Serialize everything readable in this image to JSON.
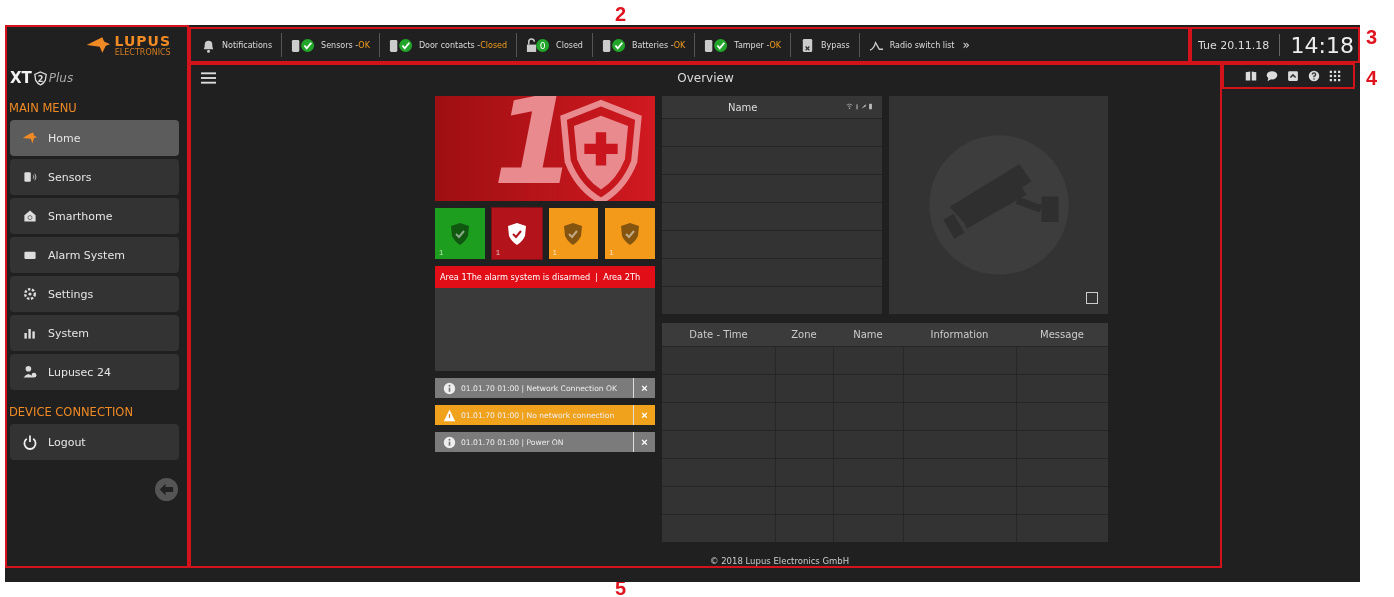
{
  "callouts": [
    "2",
    "3",
    "4",
    "5"
  ],
  "sidebar": {
    "logo": {
      "name": "LUPUS",
      "subtext": "ELECTRONICS"
    },
    "product": {
      "name": "XT",
      "badge": "2",
      "suffix": "Plus"
    },
    "sections": [
      {
        "title": "MAIN MENU",
        "items": [
          {
            "label": "Home",
            "selected": true
          },
          {
            "label": "Sensors",
            "selected": false
          },
          {
            "label": "Smarthome",
            "selected": false
          },
          {
            "label": "Alarm System",
            "selected": false
          },
          {
            "label": "Settings",
            "selected": false
          },
          {
            "label": "System",
            "selected": false
          },
          {
            "label": "Lupusec 24",
            "selected": false
          }
        ]
      },
      {
        "title": "DEVICE CONNECTION",
        "items": [
          {
            "label": "Logout",
            "selected": false
          }
        ]
      }
    ]
  },
  "status_bar": {
    "items": [
      {
        "label": "Notifications",
        "checked": false
      },
      {
        "label": "Sensors -",
        "status": "OK",
        "checked": true
      },
      {
        "label": "Door contacts -",
        "status": "Closed",
        "checked": true
      },
      {
        "label": "Closed",
        "badge": "0",
        "checked": false
      },
      {
        "label": "Batteries -",
        "status": "OK",
        "checked": true
      },
      {
        "label": "Tamper -",
        "status": "OK",
        "checked": true
      },
      {
        "label": "Bypass",
        "checked": false
      },
      {
        "label": "Radio switch list",
        "checked": false
      }
    ],
    "more": "»"
  },
  "clock": {
    "date": "Tue 20.11.18",
    "time": "14:18"
  },
  "main": {
    "title": "Overview",
    "alarm": {
      "area": "1",
      "tiles": [
        {
          "color": "#1e9e1e",
          "number": "1",
          "selected": false
        },
        {
          "color": "#b3141b",
          "number": "1",
          "selected": true
        },
        {
          "color": "#f39a1a",
          "number": "1",
          "selected": false
        },
        {
          "color": "#f39a1a",
          "number": "1",
          "selected": false
        }
      ],
      "marquee": "Area 1The alarm system is disarmed  |  Area 2Th"
    },
    "notifications": [
      {
        "kind": "info",
        "text": "01.01.70 01:00 | Network Connection OK",
        "close": "×"
      },
      {
        "kind": "warning",
        "text": "01.01.70 01:00 | No network connection",
        "close": "×"
      },
      {
        "kind": "info",
        "text": "01.01.70 01:00 | Power ON",
        "close": "×"
      }
    ],
    "sensor_table": {
      "columns": [
        "Name"
      ]
    },
    "camera": {
      "checked": false
    },
    "event_table": {
      "columns": [
        "Date - Time",
        "Zone",
        "Name",
        "Information",
        "Message"
      ]
    },
    "footer": "© 2018 Lupus Electronics GmbH"
  }
}
